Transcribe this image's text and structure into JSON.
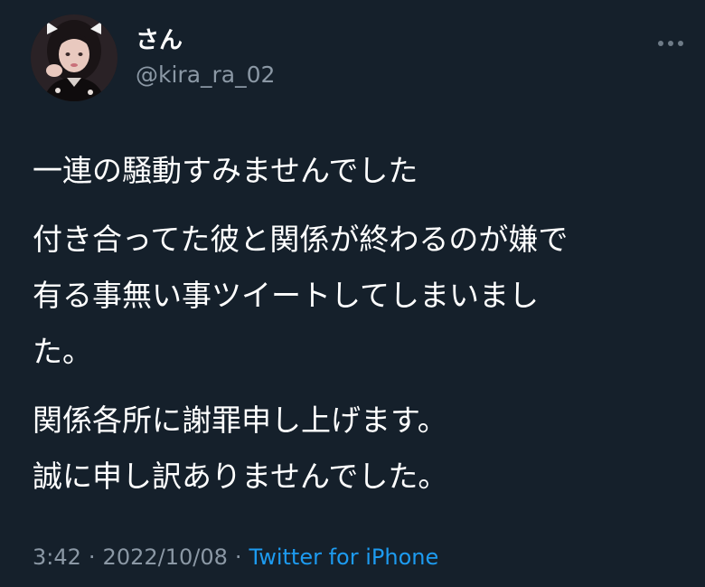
{
  "user": {
    "display_name": "さん",
    "handle": "@kira_ra_02"
  },
  "tweet": {
    "paragraphs": [
      [
        "一連の騒動すみませんでした"
      ],
      [
        "付き合ってた彼と関係が終わるのが嫌で",
        "有る事無い事ツイートしてしまいまし",
        "た。"
      ],
      [
        "関係各所に謝罪申し上げます。",
        "誠に申し訳ありませんでした。"
      ]
    ],
    "time": "3:42",
    "separator": "·",
    "date": "2022/10/08",
    "source": "Twitter for iPhone"
  },
  "colors": {
    "background": "#15202b",
    "text_primary": "#ffffff",
    "text_secondary": "#8b98a5",
    "link": "#1d9bf0"
  },
  "icons": {
    "more": "more-horizontal-icon",
    "avatar": "profile-photo"
  }
}
